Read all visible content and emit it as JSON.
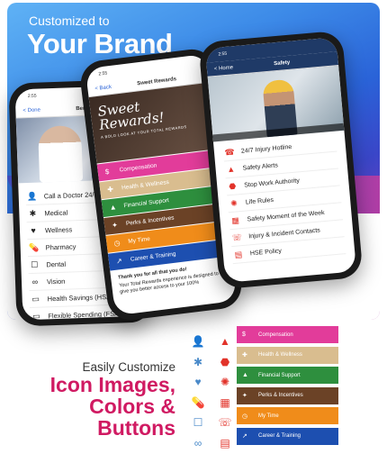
{
  "hero": {
    "subtitle": "Customized to",
    "title": "Your Brand"
  },
  "phone1": {
    "status_time": "2:55",
    "nav_back": "< Done",
    "nav_title": "Benefits",
    "items": [
      {
        "label": "Call a Doctor 24/7",
        "icon": "doctor-icon",
        "glyph": "👤"
      },
      {
        "label": "Medical",
        "icon": "medical-star-icon",
        "glyph": "✱"
      },
      {
        "label": "Wellness",
        "icon": "heart-icon",
        "glyph": "♥"
      },
      {
        "label": "Pharmacy",
        "icon": "pills-icon",
        "glyph": "💊"
      },
      {
        "label": "Dental",
        "icon": "tooth-icon",
        "glyph": "☐"
      },
      {
        "label": "Vision",
        "icon": "glasses-icon",
        "glyph": "∞"
      },
      {
        "label": "Health Savings (HSA)",
        "icon": "savings-icon",
        "glyph": "▭"
      },
      {
        "label": "Flexible Spending (FSA)",
        "icon": "spending-icon",
        "glyph": "▭"
      }
    ]
  },
  "phone2": {
    "status_time": "2:55",
    "nav_back": "< Back",
    "nav_title": "Sweet Rewards",
    "banner_script": "Sweet Rewards!",
    "banner_tag": "A BOLD LOOK AT YOUR TOTAL REWARDS",
    "buttons": [
      {
        "label": "Compensation",
        "color": "#e23c9a",
        "glyph": "$"
      },
      {
        "label": "Health & Wellness",
        "color": "#d9bd8f",
        "glyph": "✚"
      },
      {
        "label": "Financial Support",
        "color": "#2e8f3e",
        "glyph": "▲"
      },
      {
        "label": "Perks & Incentives",
        "color": "#6b4226",
        "glyph": "✦"
      },
      {
        "label": "My Time",
        "color": "#f08c1a",
        "glyph": "◷"
      },
      {
        "label": "Career & Training",
        "color": "#1d4fb0",
        "glyph": "↗"
      }
    ],
    "thanks": "Thank you for all that you do!",
    "body": "Your Total Rewards experience is designed to give you better access to your 100%"
  },
  "phone3": {
    "status_time": "2:55",
    "nav_back": "< Home",
    "nav_title": "Safety",
    "items": [
      {
        "label": "24/7 Injury Hotline",
        "icon": "phone-icon",
        "glyph": "☎"
      },
      {
        "label": "Safety Alerts",
        "icon": "warning-icon",
        "glyph": "▲"
      },
      {
        "label": "Stop Work Authority",
        "icon": "stop-icon",
        "glyph": "⬣"
      },
      {
        "label": "Life Rules",
        "icon": "sun-icon",
        "glyph": "✺"
      },
      {
        "label": "Safety Moment of the Week",
        "icon": "calendar-icon",
        "glyph": "▦"
      },
      {
        "label": "Injury & Incident Contacts",
        "icon": "phone-incident-icon",
        "glyph": "☏"
      },
      {
        "label": "HSE Policy",
        "icon": "document-icon",
        "glyph": "▤"
      }
    ]
  },
  "bottom": {
    "small": "Easily Customize",
    "big_lines": [
      "Icon Images,",
      "Colors &",
      "Buttons"
    ]
  },
  "icon_pairs": [
    {
      "a": "👤",
      "b": "▲",
      "a_name": "doctor-icon",
      "b_name": "warning-icon"
    },
    {
      "a": "✱",
      "b": "⬣",
      "a_name": "medical-star-icon",
      "b_name": "stop-icon"
    },
    {
      "a": "♥",
      "b": "✺",
      "a_name": "heart-icon",
      "b_name": "sun-icon"
    },
    {
      "a": "💊",
      "b": "▦",
      "a_name": "pills-icon",
      "b_name": "calendar-icon"
    },
    {
      "a": "☐",
      "b": "☏",
      "a_name": "tooth-icon",
      "b_name": "phone-incident-icon"
    },
    {
      "a": "∞",
      "b": "▤",
      "a_name": "glasses-icon",
      "b_name": "document-icon"
    }
  ],
  "button_stack": [
    {
      "label": "Compensation",
      "color": "#e23c9a",
      "glyph": "$"
    },
    {
      "label": "Health & Wellness",
      "color": "#d9bd8f",
      "glyph": "✚"
    },
    {
      "label": "Financial Support",
      "color": "#2e8f3e",
      "glyph": "▲"
    },
    {
      "label": "Perks & Incentives",
      "color": "#6b4226",
      "glyph": "✦"
    },
    {
      "label": "My Time",
      "color": "#f08c1a",
      "glyph": "◷"
    },
    {
      "label": "Career & Training",
      "color": "#1d4fb0",
      "glyph": "↗"
    }
  ]
}
